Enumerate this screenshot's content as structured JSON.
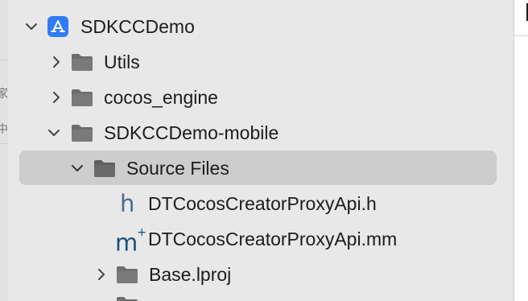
{
  "colors": {
    "sidebar_bg": "#e8e8e8",
    "selection_bg": "#cdcdcd",
    "folder_icon": "#6e6e6e",
    "app_icon": "#2f7cf6",
    "h_file_icon": "#4a6a8a",
    "mm_file_icon": "#1d4f7a"
  },
  "tree": {
    "project": {
      "label": "SDKCCDemo",
      "icon": "xcode-app-icon",
      "expanded": true
    },
    "items": [
      {
        "label": "Utils",
        "icon": "folder-icon",
        "expanded": false
      },
      {
        "label": "cocos_engine",
        "icon": "folder-icon",
        "expanded": false
      },
      {
        "label": "SDKCCDemo-mobile",
        "icon": "folder-icon",
        "expanded": true
      },
      {
        "label": "Source Files",
        "icon": "folder-icon",
        "expanded": true,
        "selected": true
      },
      {
        "label": "DTCocosCreatorProxyApi.h",
        "icon": "header-file-icon",
        "glyph": "h"
      },
      {
        "label": "DTCocosCreatorProxyApi.mm",
        "icon": "objc-impl-file-icon",
        "glyph": "m",
        "glyph_sup": "+"
      },
      {
        "label": "Base.lproj",
        "icon": "folder-icon",
        "expanded": false
      }
    ]
  },
  "left_strip": {
    "glyph1": "家",
    "glyph2": "中"
  }
}
